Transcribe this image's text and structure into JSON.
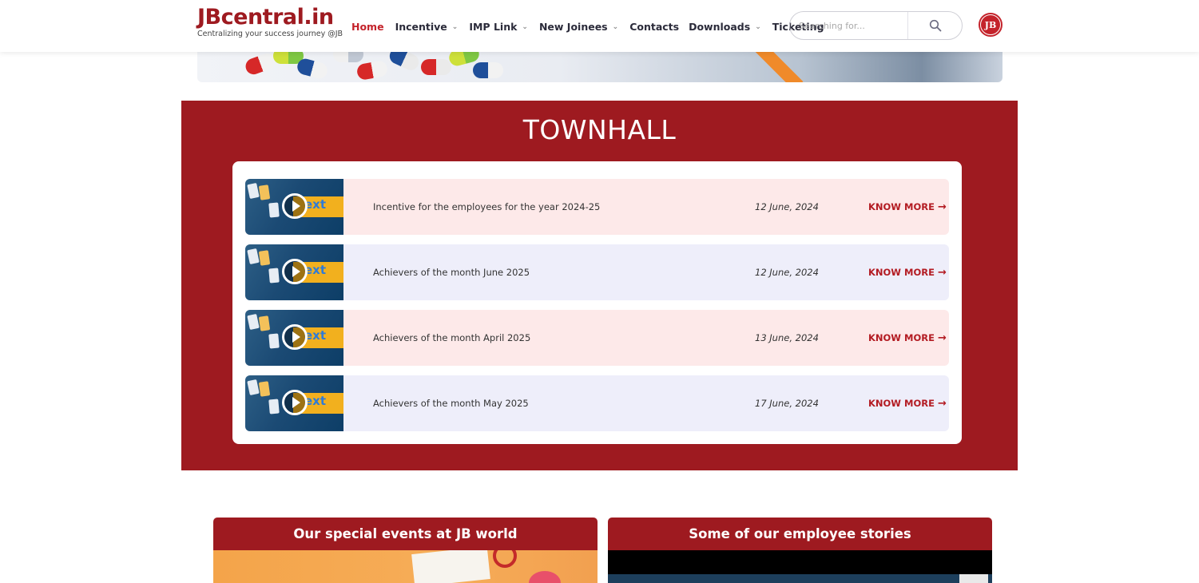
{
  "header": {
    "logo_text": "JBcentral.in",
    "tagline": "Centralizing your success journey @JB",
    "avatar_text": "JB",
    "nav": [
      {
        "label": "Home",
        "dropdown": false,
        "active": true
      },
      {
        "label": "Incentive",
        "dropdown": true,
        "active": false
      },
      {
        "label": "IMP Link",
        "dropdown": true,
        "active": false
      },
      {
        "label": "New Joinees",
        "dropdown": true,
        "active": false
      },
      {
        "label": "Contacts",
        "dropdown": false,
        "active": false
      },
      {
        "label": "Downloads",
        "dropdown": true,
        "active": false
      },
      {
        "label": "Ticketing",
        "dropdown": false,
        "active": false
      }
    ],
    "search": {
      "placeholder": "Searching for...",
      "value": ""
    }
  },
  "townhall": {
    "title": "TOWNHALL",
    "thumbnail_text": "ext",
    "items": [
      {
        "title": "Incentive for the employees for the year 2024-25",
        "date": "12 June, 2024",
        "action": "KNOW MORE"
      },
      {
        "title": "Achievers of the month June 2025",
        "date": "12 June, 2024",
        "action": "KNOW MORE"
      },
      {
        "title": "Achievers of the month April 2025",
        "date": "13 June, 2024",
        "action": "KNOW MORE"
      },
      {
        "title": "Achievers of the month May 2025",
        "date": "17 June, 2024",
        "action": "KNOW MORE"
      }
    ]
  },
  "sections": {
    "events_title": "Our special events at JB world",
    "stories_title": "Some of our employee stories"
  },
  "colors": {
    "brand_red": "#9e1a20",
    "nav_active": "#c4232b",
    "row_pink": "#fde9e9",
    "row_blue": "#eeeefa"
  }
}
